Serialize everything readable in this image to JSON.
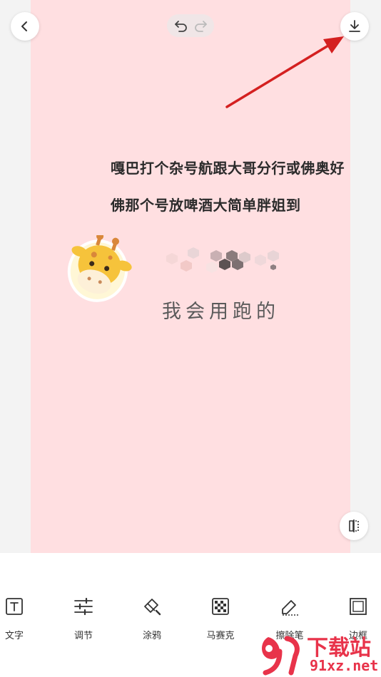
{
  "canvas": {
    "line1": "嘎巴打个杂号航跟大哥分行或佛奥好",
    "line2": "佛那个号放啤酒大简单胖姐到",
    "handwritten": "我会用跑的",
    "sticker": "giraffe-sticker"
  },
  "top_bar": {
    "back_icon": "chevron-left-icon",
    "undo_icon": "undo-icon",
    "redo_icon": "redo-icon",
    "download_icon": "download-icon"
  },
  "toolbar": {
    "items": [
      {
        "label": "文字",
        "icon": "text-icon"
      },
      {
        "label": "调节",
        "icon": "adjust-icon"
      },
      {
        "label": "涂鸦",
        "icon": "brush-icon"
      },
      {
        "label": "马赛克",
        "icon": "mosaic-icon"
      },
      {
        "label": "擦除笔",
        "icon": "eraser-icon"
      },
      {
        "label": "边框",
        "icon": "frame-icon"
      }
    ]
  },
  "watermark": {
    "brand": "下载站",
    "domain": "91xz.net"
  },
  "colors": {
    "canvas_bg": "#ffdfe1",
    "arrow": "#d42020",
    "watermark": "#e8334a"
  }
}
